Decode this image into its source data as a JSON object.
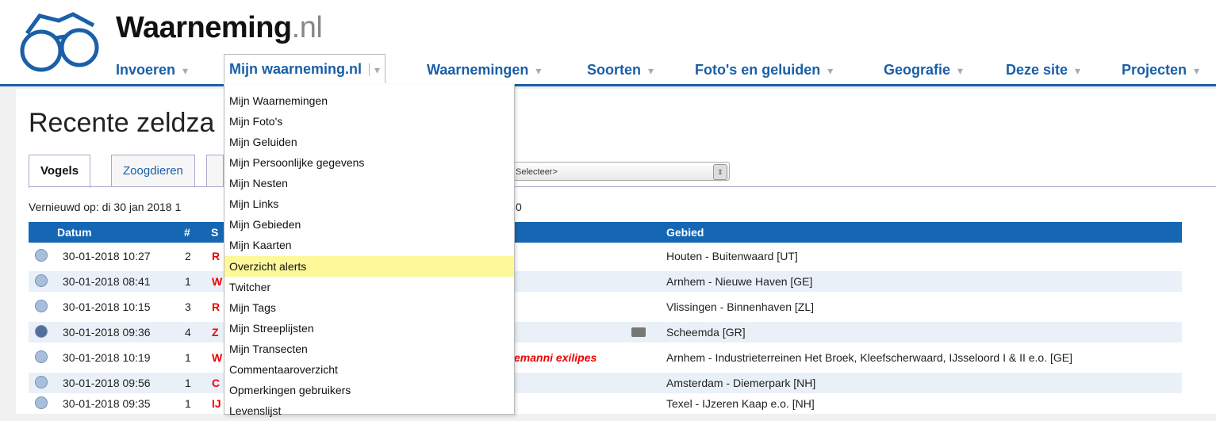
{
  "site": {
    "title": "Waarneming",
    "tld": ".nl"
  },
  "nav": [
    {
      "label": "Invoeren"
    },
    {
      "label": "Mijn waarneming.nl"
    },
    {
      "label": "Waarnemingen"
    },
    {
      "label": "Soorten"
    },
    {
      "label": "Foto's en geluiden"
    },
    {
      "label": "Geografie"
    },
    {
      "label": "Deze site"
    },
    {
      "label": "Projecten"
    }
  ],
  "page": {
    "title": "Recente zeldza",
    "tabs": [
      {
        "label": "Vogels"
      },
      {
        "label": "Zoogdieren"
      }
    ],
    "select_value": "Selecteer>",
    "updated": "Vernieuwd op: di 30 jan 2018 1",
    "updated_tail": "0"
  },
  "table": {
    "headers": {
      "datum": "Datum",
      "count": "#",
      "s": "S",
      "gebied": "Gebied"
    },
    "rows": [
      {
        "date": "30-01-2018 10:27",
        "count": "2",
        "s": "R",
        "extra": "",
        "gebied": "Houten - Buitenwaard [UT]"
      },
      {
        "date": "30-01-2018 08:41",
        "count": "1",
        "s": "W",
        "extra": "",
        "gebied": "Arnhem - Nieuwe Haven [GE]"
      },
      {
        "date": "30-01-2018 10:15",
        "count": "3",
        "s": "R",
        "extra": "",
        "gebied": "Vlissingen - Binnenhaven [ZL]"
      },
      {
        "date": "30-01-2018 09:36",
        "count": "4",
        "s": "Z",
        "extra": "",
        "gebied": "Scheemda [GR]"
      },
      {
        "date": "30-01-2018 10:19",
        "count": "1",
        "s": "W",
        "extra": "emanni exilipes",
        "gebied": "Arnhem - Industrieterreinen Het Broek, Kleefscherwaard, IJsseloord I & II e.o. [GE]"
      },
      {
        "date": "30-01-2018 09:56",
        "count": "1",
        "s": "C",
        "extra": "",
        "gebied": "Amsterdam - Diemerpark [NH]"
      },
      {
        "date": "30-01-2018 09:35",
        "count": "1",
        "s": "IJ",
        "extra": "",
        "gebied": "Texel - IJzeren Kaap e.o. [NH]"
      }
    ]
  },
  "dropdown": [
    {
      "label": "Mijn Waarnemingen"
    },
    {
      "label": "Mijn Foto's"
    },
    {
      "label": "Mijn Geluiden"
    },
    {
      "label": "Mijn Persoonlijke gegevens"
    },
    {
      "label": "Mijn Nesten"
    },
    {
      "label": "Mijn Links"
    },
    {
      "label": "Mijn Gebieden"
    },
    {
      "label": "Mijn Kaarten"
    },
    {
      "label": "Overzicht alerts"
    },
    {
      "label": "Twitcher"
    },
    {
      "label": "Mijn Tags"
    },
    {
      "label": "Mijn Streeplijsten"
    },
    {
      "label": "Mijn Transecten"
    },
    {
      "label": "Commentaaroverzicht"
    },
    {
      "label": "Opmerkingen gebruikers"
    },
    {
      "label": "Levenslijst"
    }
  ]
}
